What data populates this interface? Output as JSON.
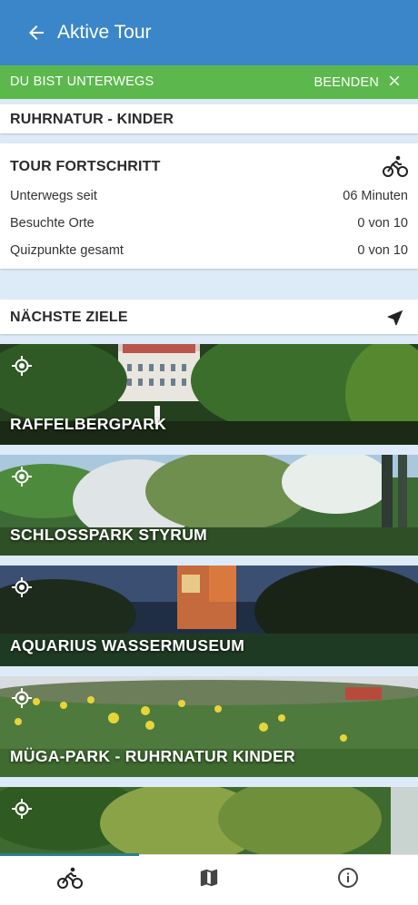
{
  "header": {
    "title": "Aktive Tour"
  },
  "banner": {
    "status": "DU BIST UNTERWEGS",
    "end_label": "BEENDEN"
  },
  "tour": {
    "name": "RUHRNATUR - KINDER"
  },
  "progress": {
    "title": "TOUR FORTSCHRITT",
    "rows": [
      {
        "key": "Unterwegs seit",
        "value": "06 Minuten"
      },
      {
        "key": "Besuchte Orte",
        "value": "0 von 10"
      },
      {
        "key": "Quizpunkte gesamt",
        "value": "0 von 10"
      }
    ]
  },
  "next": {
    "title": "NÄCHSTE ZIELE"
  },
  "destinations": [
    {
      "label": "RAFFELBERGPARK"
    },
    {
      "label": "SCHLOSSPARK STYRUM"
    },
    {
      "label": "AQUARIUS WASSERMUSEUM"
    },
    {
      "label": "MÜGA-PARK - RUHRNATUR KINDER"
    },
    {
      "label": ""
    }
  ],
  "colors": {
    "appbar": "#3a86c8",
    "banner": "#5cb84c",
    "background": "#dcebf7",
    "tab_indicator": "#2c7f8a"
  },
  "icons": [
    "arrow-back-icon",
    "close-icon",
    "bicycle-icon",
    "navigation-arrow-icon",
    "gps-target-icon",
    "map-icon",
    "info-icon"
  ]
}
